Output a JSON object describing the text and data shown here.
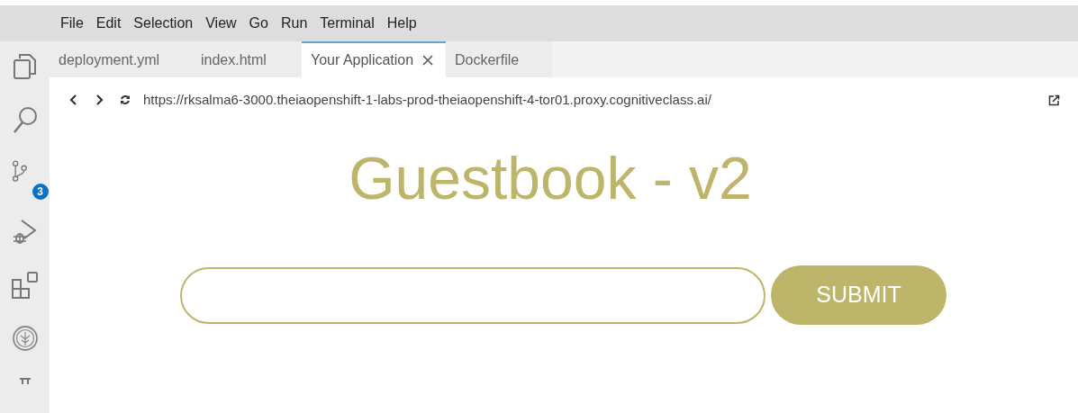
{
  "menu_bar": {
    "items": [
      "File",
      "Edit",
      "Selection",
      "View",
      "Go",
      "Run",
      "Terminal",
      "Help"
    ]
  },
  "activity_bar": {
    "items": [
      {
        "kind": "explorer"
      },
      {
        "kind": "search"
      },
      {
        "kind": "source-control",
        "badge": "3"
      },
      {
        "kind": "debug"
      },
      {
        "kind": "extensions"
      },
      {
        "kind": "tree"
      },
      {
        "kind": "partial"
      }
    ]
  },
  "tabs": [
    {
      "label": "deployment.yml",
      "selected": false,
      "closable": false
    },
    {
      "label": "index.html",
      "selected": false,
      "closable": false
    },
    {
      "label": "Your Application",
      "selected": true,
      "closable": true
    },
    {
      "label": "Dockerfile",
      "selected": false,
      "closable": false
    }
  ],
  "browser": {
    "url": "https://rksalma6-3000.theiaopenshift-1-labs-prod-theiaopenshift-4-tor01.proxy.cognitiveclass.ai/"
  },
  "page": {
    "heading": "Guestbook - v2",
    "submit_label": "SUBMIT"
  }
}
